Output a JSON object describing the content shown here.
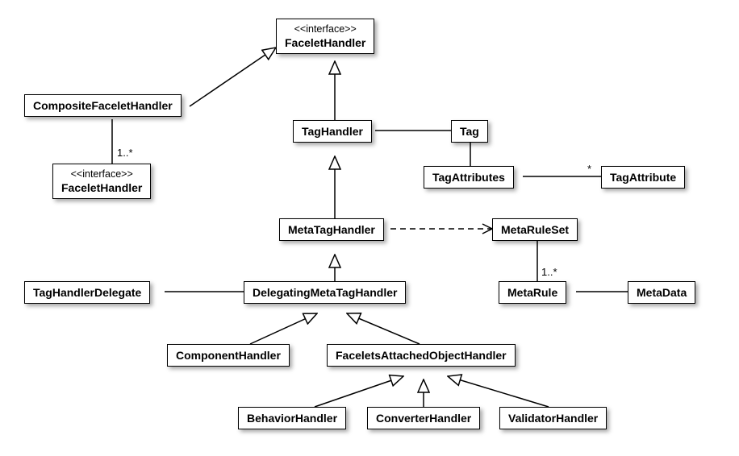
{
  "diagram": {
    "type": "uml-class-diagram",
    "nodes": {
      "faceletHandlerTop": {
        "stereotype": "<<interface>>",
        "name": "FaceletHandler"
      },
      "compositeFaceletHandler": {
        "name": "CompositeFaceletHandler"
      },
      "faceletHandlerNested": {
        "stereotype": "<<interface>>",
        "name": "FaceletHandler"
      },
      "tagHandler": {
        "name": "TagHandler"
      },
      "tag": {
        "name": "Tag"
      },
      "tagAttributes": {
        "name": "TagAttributes"
      },
      "tagAttribute": {
        "name": "TagAttribute"
      },
      "metaTagHandler": {
        "name": "MetaTagHandler"
      },
      "metaRuleSet": {
        "name": "MetaRuleSet"
      },
      "tagHandlerDelegate": {
        "name": "TagHandlerDelegate"
      },
      "delegatingMetaTagHandler": {
        "name": "DelegatingMetaTagHandler"
      },
      "metaRule": {
        "name": "MetaRule"
      },
      "metaData": {
        "name": "MetaData"
      },
      "componentHandler": {
        "name": "ComponentHandler"
      },
      "faceletsAttachedObjectHandler": {
        "name": "FaceletsAttachedObjectHandler"
      },
      "behaviorHandler": {
        "name": "BehaviorHandler"
      },
      "converterHandler": {
        "name": "ConverterHandler"
      },
      "validatorHandler": {
        "name": "ValidatorHandler"
      }
    },
    "multiplicities": {
      "composite_to_nested": "1..*",
      "tagAttributes_to_tagAttribute": "*",
      "metaRuleSet_to_metaRule": "1..*"
    },
    "edges": [
      {
        "from": "compositeFaceletHandler",
        "to": "faceletHandlerTop",
        "kind": "realization"
      },
      {
        "from": "tagHandler",
        "to": "faceletHandlerTop",
        "kind": "realization"
      },
      {
        "from": "compositeFaceletHandler",
        "to": "faceletHandlerNested",
        "kind": "association",
        "mult_to": "1..*"
      },
      {
        "from": "tagHandler",
        "to": "tag",
        "kind": "association"
      },
      {
        "from": "tag",
        "to": "tagAttributes",
        "kind": "association"
      },
      {
        "from": "tagAttributes",
        "to": "tagAttribute",
        "kind": "association",
        "mult_to": "*"
      },
      {
        "from": "metaTagHandler",
        "to": "tagHandler",
        "kind": "generalization"
      },
      {
        "from": "metaTagHandler",
        "to": "metaRuleSet",
        "kind": "dependency"
      },
      {
        "from": "delegatingMetaTagHandler",
        "to": "metaTagHandler",
        "kind": "generalization"
      },
      {
        "from": "tagHandlerDelegate",
        "to": "delegatingMetaTagHandler",
        "kind": "association"
      },
      {
        "from": "metaRuleSet",
        "to": "metaRule",
        "kind": "association",
        "mult_to": "1..*"
      },
      {
        "from": "metaRule",
        "to": "metaData",
        "kind": "association"
      },
      {
        "from": "componentHandler",
        "to": "delegatingMetaTagHandler",
        "kind": "generalization"
      },
      {
        "from": "faceletsAttachedObjectHandler",
        "to": "delegatingMetaTagHandler",
        "kind": "generalization"
      },
      {
        "from": "behaviorHandler",
        "to": "faceletsAttachedObjectHandler",
        "kind": "generalization"
      },
      {
        "from": "converterHandler",
        "to": "faceletsAttachedObjectHandler",
        "kind": "generalization"
      },
      {
        "from": "validatorHandler",
        "to": "faceletsAttachedObjectHandler",
        "kind": "generalization"
      }
    ]
  }
}
